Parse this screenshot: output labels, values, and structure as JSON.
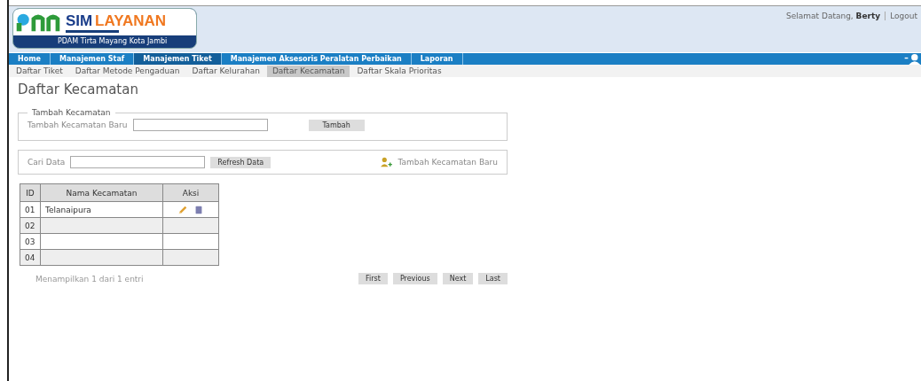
{
  "header": {
    "logo_title_1": "SIM",
    "logo_title_2": "LAYANAN",
    "logo_subtitle": "PDAM Tirta Mayang Kota Jambi",
    "welcome": "Selamat Datang, ",
    "user": "Berty",
    "logout": "Logout"
  },
  "nav": [
    {
      "label": "Home",
      "selected": false
    },
    {
      "label": "Manajemen Staf",
      "selected": false
    },
    {
      "label": "Manajemen Tiket",
      "selected": true
    },
    {
      "label": "Manajemen Aksesoris Peralatan Perbaikan",
      "selected": false
    },
    {
      "label": "Laporan",
      "selected": false
    }
  ],
  "subnav": [
    {
      "label": "Daftar Tiket",
      "selected": false
    },
    {
      "label": "Daftar Metode Pengaduan",
      "selected": false
    },
    {
      "label": "Daftar Kelurahan",
      "selected": false
    },
    {
      "label": "Daftar Kecamatan",
      "selected": true
    },
    {
      "label": "Daftar Skala Prioritas",
      "selected": false
    }
  ],
  "page_title": "Daftar Kecamatan",
  "add_form": {
    "legend": "Tambah Kecamatan",
    "label": "Tambah Kecamatan Baru",
    "button": "Tambah"
  },
  "search": {
    "label": "Cari Data",
    "button": "Refresh Data",
    "add_link": "Tambah Kecamatan Baru"
  },
  "table": {
    "columns": [
      "ID",
      "Nama Kecamatan",
      "Aksi"
    ],
    "rows": [
      {
        "id": "01",
        "name": "Telanaipura",
        "actions": true
      },
      {
        "id": "02",
        "name": "",
        "actions": false
      },
      {
        "id": "03",
        "name": "",
        "actions": false
      },
      {
        "id": "04",
        "name": "",
        "actions": false
      }
    ]
  },
  "footer": {
    "info": "Menampilkan 1 dari 1 entri",
    "pager": [
      "First",
      "Previous",
      "Next",
      "Last"
    ]
  }
}
